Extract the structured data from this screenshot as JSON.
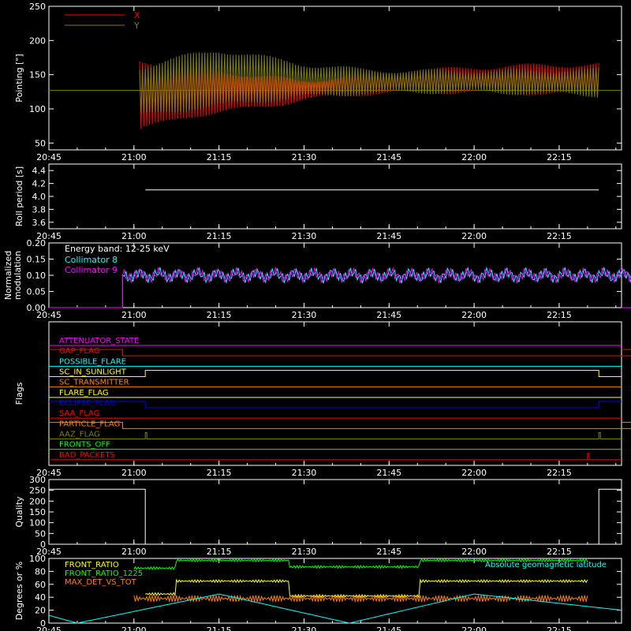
{
  "time_axis": {
    "range": [
      "20:45",
      "22:26"
    ],
    "tick_labels": [
      "20:45",
      "21:00",
      "21:15",
      "21:30",
      "21:45",
      "22:00",
      "22:15"
    ]
  },
  "colors": {
    "background": "#000000",
    "axes": "#ffffff",
    "x_series": "#ff0000",
    "y_series": "#808000",
    "collimator8": "#00ffff",
    "collimator9": "#ff00ff",
    "front_ratio": "#ffff00",
    "front_ratio_1225": "#00ff00",
    "max_det": "#ff8000",
    "latitude": "#00ffff"
  },
  "chart_data": [
    {
      "id": "pointing",
      "type": "line",
      "ylabel": "Pointing [\"]",
      "ylim": [
        40,
        250
      ],
      "y_ticks": [
        "50",
        "100",
        "150",
        "200",
        "250"
      ],
      "series": [
        {
          "name": "X",
          "color": "#ff0000",
          "kind": "band",
          "time": [
            "21:01",
            "21:10",
            "21:20",
            "21:30",
            "21:40",
            "21:50",
            "22:00",
            "22:10",
            "22:22"
          ],
          "upper": [
            170,
            160,
            150,
            140,
            150,
            155,
            160,
            163,
            165
          ],
          "lower": [
            70,
            90,
            100,
            113,
            122,
            125,
            125,
            123,
            120
          ]
        },
        {
          "name": "Y",
          "color": "#808000",
          "kind": "band",
          "time": [
            "21:01",
            "21:10",
            "21:15",
            "21:20",
            "21:30",
            "21:40",
            "21:50",
            "22:00",
            "22:10",
            "22:22"
          ],
          "upper": [
            160,
            178,
            185,
            180,
            165,
            157,
            155,
            155,
            155,
            157
          ],
          "lower": [
            90,
            100,
            105,
            110,
            118,
            123,
            125,
            125,
            123,
            120
          ]
        }
      ],
      "baseline": 127
    },
    {
      "id": "roll-period",
      "type": "line",
      "ylabel": "Roll period [s]",
      "ylim": [
        3.5,
        4.5
      ],
      "y_ticks": [
        "3.6",
        "3.8",
        "4.0",
        "4.2",
        "4.4"
      ],
      "series": [
        {
          "name": "",
          "color": "#ffffff",
          "time": [
            "21:02",
            "22:22"
          ],
          "values": [
            4.1,
            4.1
          ]
        }
      ]
    },
    {
      "id": "modulation",
      "type": "line",
      "ylabel": "Normalized modulation",
      "ylim": [
        0,
        0.2
      ],
      "y_ticks": [
        "0.00",
        "0.05",
        "0.10",
        "0.15",
        "0.20"
      ],
      "annotation": "Energy band: 12-25 keV",
      "series": [
        {
          "name": "Collimator 8",
          "color": "#00ffff",
          "time": [
            "20:58",
            "22:30"
          ],
          "values": [
            0.1,
            0.1
          ]
        },
        {
          "name": "Collimator 9",
          "color": "#ff00ff",
          "time": [
            "20:58",
            "22:30"
          ],
          "values": [
            0.1,
            0.1
          ]
        }
      ]
    },
    {
      "id": "flags",
      "type": "line",
      "ylabel": "Flags",
      "series": [
        {
          "name": "ATTENUATOR_STATE",
          "color": "#ff00ff",
          "transitions": []
        },
        {
          "name": "GAP_FLAG",
          "color": "#ff0000",
          "transitions": [
            "20:58",
            "22:30"
          ],
          "initial": 1
        },
        {
          "name": "POSSIBLE_FLARE",
          "color": "#00ffff",
          "transitions": []
        },
        {
          "name": "SC_IN_SUNLIGHT",
          "color": "#ffff00",
          "transitions": [
            "21:02",
            "22:22"
          ],
          "initial": 0
        },
        {
          "name": "SC_TRANSMITTER",
          "color": "#ff8000",
          "transitions": []
        },
        {
          "name": "FLARE_FLAG",
          "color": "#ffff00",
          "transitions": []
        },
        {
          "name": "ECLIPSE_FLAG",
          "color": "#0000ff",
          "transitions": [
            "21:02",
            "22:22"
          ],
          "initial": 1
        },
        {
          "name": "SAA_FLAG",
          "color": "#ff0000",
          "transitions": []
        },
        {
          "name": "PARTICLE_FLAG",
          "color": "#ff8000",
          "transitions": [
            "20:58",
            "22:30"
          ],
          "initial": 1
        },
        {
          "name": "AAZ_FLAG",
          "color": "#808000",
          "spikes": [
            "21:02",
            "22:22"
          ]
        },
        {
          "name": "FRONTS_OFF",
          "color": "#00ff00",
          "transitions": []
        },
        {
          "name": "BAD_PACKETS",
          "color": "#ff0000",
          "spikes": [
            "22:20"
          ]
        }
      ]
    },
    {
      "id": "quality",
      "type": "line",
      "ylabel": "Quality",
      "ylim": [
        0,
        300
      ],
      "y_ticks": [
        "0",
        "50",
        "100",
        "150",
        "200",
        "250",
        "300"
      ],
      "series": [
        {
          "name": "",
          "color": "#ffffff",
          "time": [
            "20:45",
            "21:02",
            "21:02",
            "22:22",
            "22:22",
            "22:26"
          ],
          "values": [
            255,
            255,
            0,
            0,
            255,
            255
          ]
        }
      ]
    },
    {
      "id": "ratios",
      "type": "line",
      "ylabel": "Degrees or %",
      "ylim": [
        0,
        100
      ],
      "y_ticks": [
        "0",
        "20",
        "40",
        "60",
        "80",
        "100"
      ],
      "series": [
        {
          "name": "FRONT_RATIO",
          "color": "#ffff00",
          "time": [
            "21:02",
            "21:07",
            "21:07",
            "21:27",
            "21:27",
            "21:50",
            "21:50",
            "22:20"
          ],
          "values": [
            45,
            45,
            65,
            65,
            42,
            42,
            65,
            65
          ]
        },
        {
          "name": "FRONT_RATIO_1225",
          "color": "#00ff00",
          "time": [
            "21:00",
            "21:07",
            "21:07",
            "21:27",
            "21:27",
            "21:50",
            "21:50",
            "22:20"
          ],
          "values": [
            85,
            85,
            97,
            97,
            87,
            87,
            97,
            97
          ]
        },
        {
          "name": "MAX_DET_VS_TOT",
          "color": "#ff8000",
          "time": [
            "21:00",
            "22:20"
          ],
          "values": [
            38,
            38
          ]
        },
        {
          "name": "Absolute geomagnetic latitude",
          "color": "#00ffff",
          "time": [
            "20:45",
            "20:50",
            "21:15",
            "21:38",
            "22:00",
            "22:26"
          ],
          "values": [
            12,
            0,
            45,
            0,
            45,
            20
          ]
        }
      ]
    }
  ]
}
